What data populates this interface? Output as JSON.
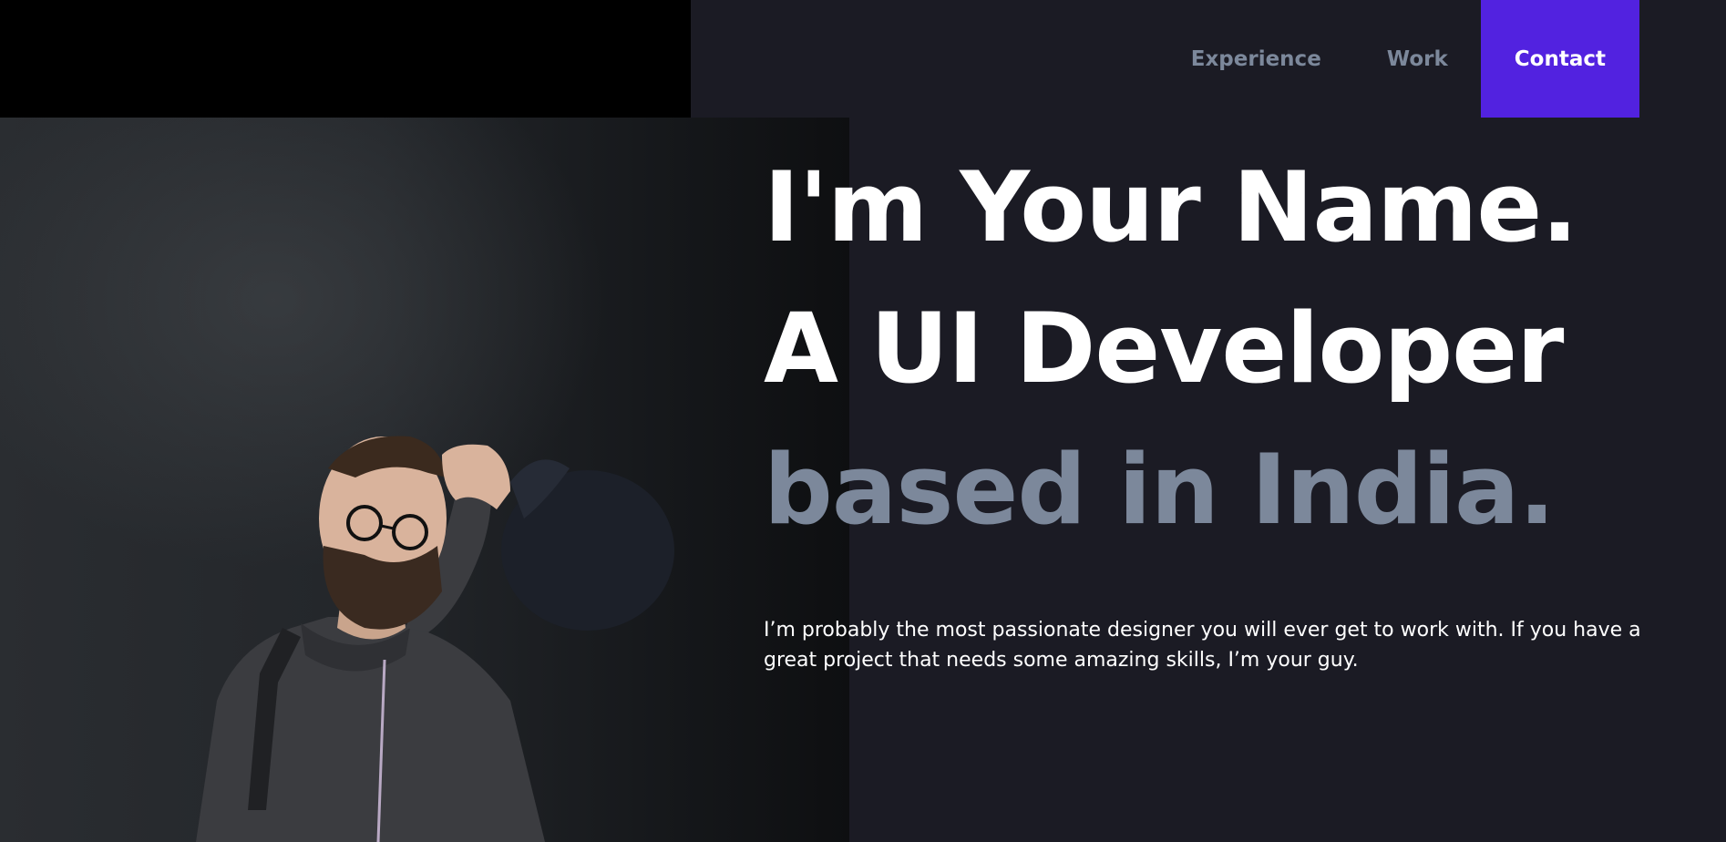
{
  "nav": {
    "items": [
      {
        "label": "Experience"
      },
      {
        "label": "Work"
      },
      {
        "label": "Contact"
      }
    ]
  },
  "hero": {
    "line1": "I'm Your Name.",
    "line2": "A UI Developer",
    "line3": "based in India.",
    "description": "I’m probably the most passionate designer you will ever get to work with. If you have a great project that needs some amazing skills, I’m your guy."
  },
  "colors": {
    "background": "#1b1b24",
    "accent": "#5222e0",
    "muted_text": "#7c889b",
    "text": "#ffffff"
  }
}
